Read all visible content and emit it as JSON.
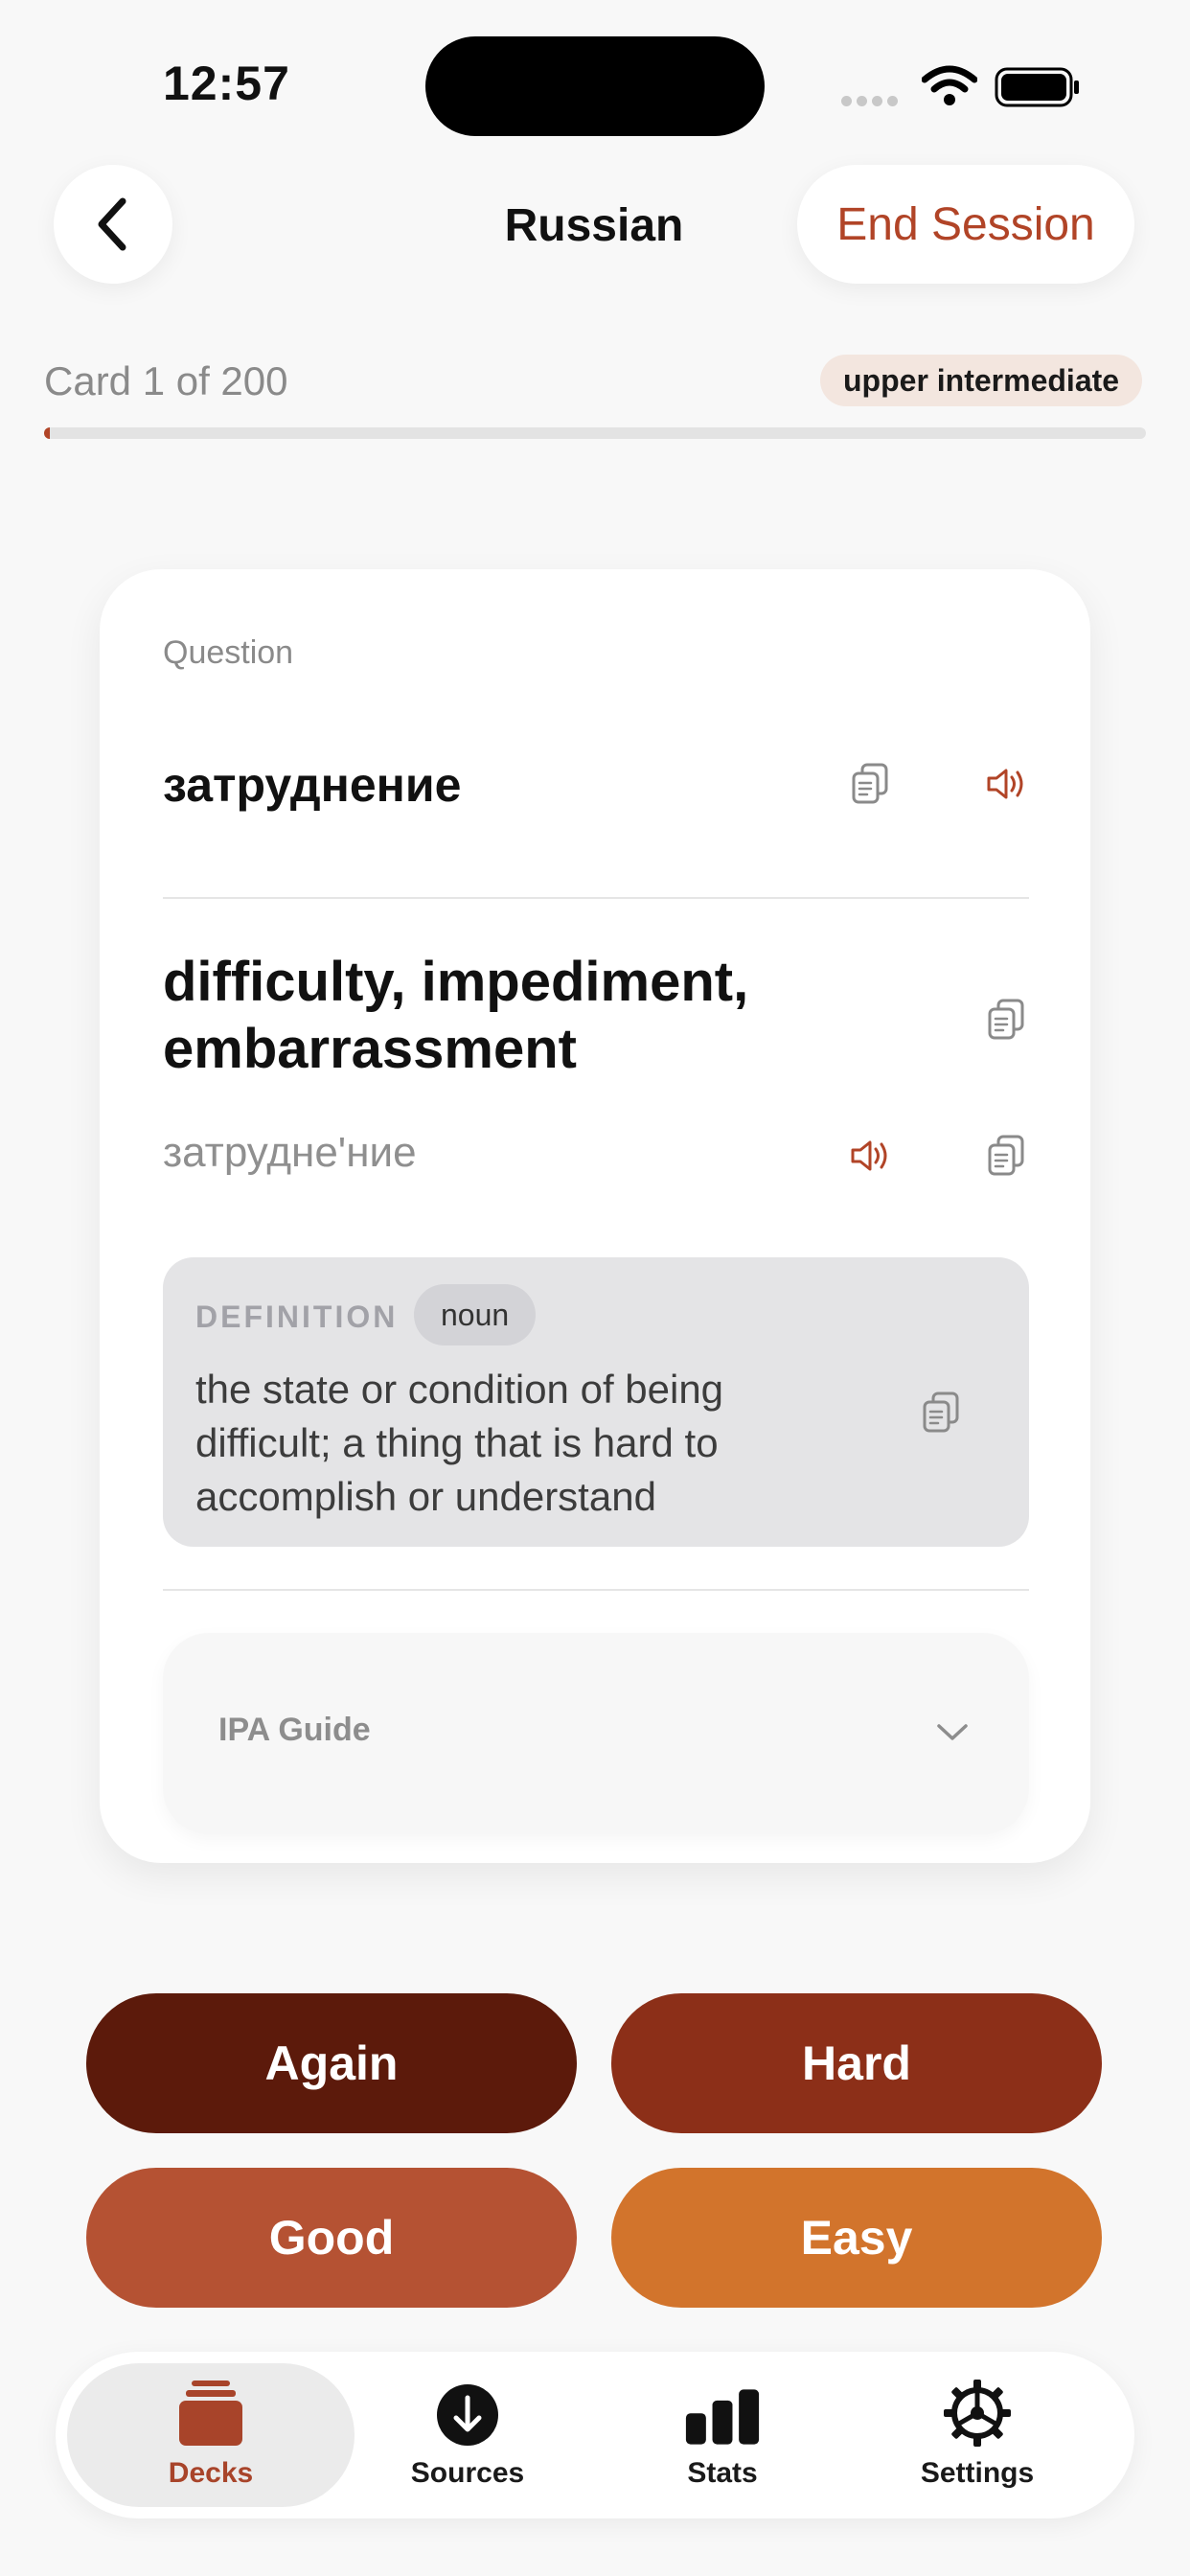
{
  "status_bar": {
    "time": "12:57"
  },
  "header": {
    "title": "Russian",
    "end_label": "End Session"
  },
  "progress": {
    "count_label": "Card 1 of 200",
    "level": "upper intermediate",
    "fraction": 0.005
  },
  "card": {
    "question_label": "Question",
    "question_word": "затруднение",
    "answer": "difficulty, impediment, embarrassment",
    "transliteration": "затрудне'ние",
    "definition_label": "DEFINITION",
    "part_of_speech": "noun",
    "definition": "the state or condition of being difficult; a thing that is hard to accomplish or understand",
    "ipa_label": "IPA Guide"
  },
  "ratings": [
    {
      "label": "Again",
      "color": "#5c1a0b"
    },
    {
      "label": "Hard",
      "color": "#8c2f18"
    },
    {
      "label": "Good",
      "color": "#b55233"
    },
    {
      "label": "Easy",
      "color": "#d2742c"
    }
  ],
  "tabs": [
    {
      "label": "Decks",
      "icon": "decks-icon",
      "active": true
    },
    {
      "label": "Sources",
      "icon": "download-icon",
      "active": false
    },
    {
      "label": "Stats",
      "icon": "stats-icon",
      "active": false
    },
    {
      "label": "Settings",
      "icon": "gear-icon",
      "active": false
    }
  ],
  "colors": {
    "accent": "#b14427",
    "speaker": "#b14427",
    "copy_icon": "#8a8a8a"
  }
}
